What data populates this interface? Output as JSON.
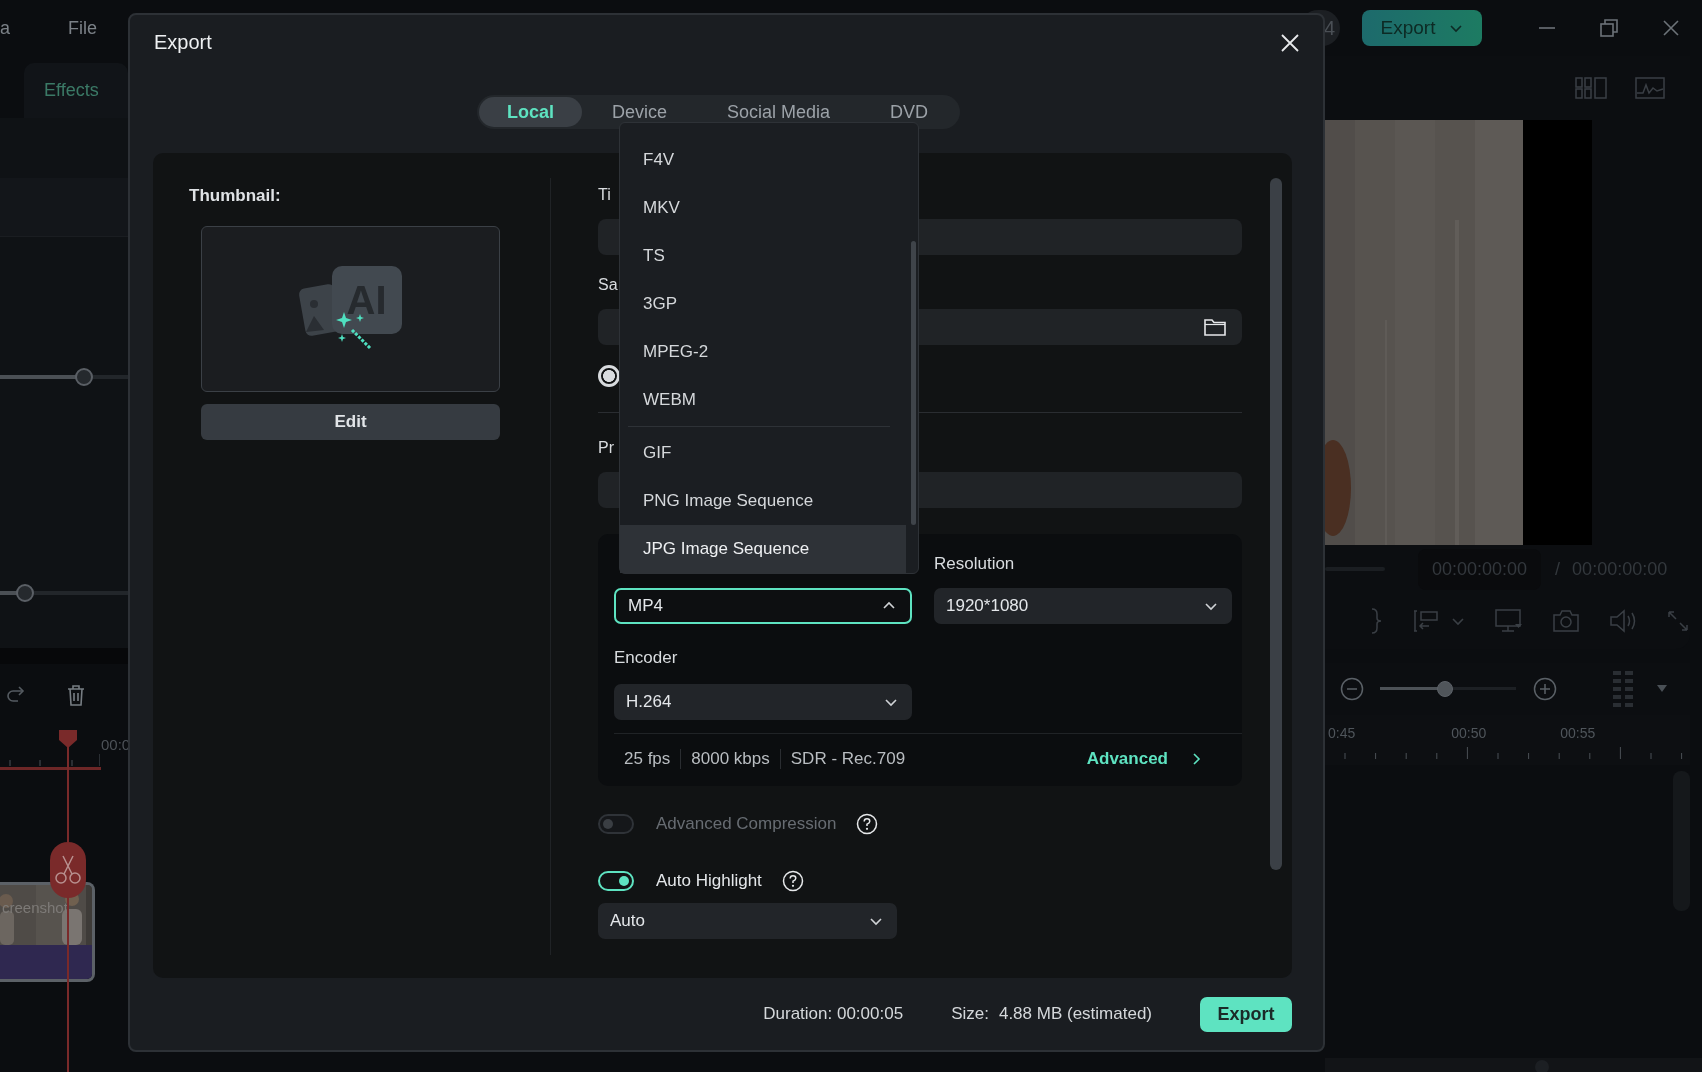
{
  "app_menu": [
    {
      "label": "a"
    },
    {
      "label": "File"
    }
  ],
  "top_bar": {
    "badge": "4",
    "export_button": "Export"
  },
  "left_panel": {
    "tab": "Effects",
    "sliders": [
      {
        "level": 0.65
      },
      {
        "level": 0.19
      }
    ],
    "ruler_label": "00:0",
    "clip_label": "creenshot"
  },
  "player": {
    "current_time": "00:00:00:00",
    "separator": "/",
    "total_time": "00:00:00:00"
  },
  "timeline": {
    "zoom": {
      "level": 0.48
    },
    "ruler_labels": [
      "0:45",
      "00:50",
      "00:55"
    ]
  },
  "dialog": {
    "title": "Export",
    "tabs": [
      {
        "label": "Local",
        "selected": true
      },
      {
        "label": "Device",
        "selected": false
      },
      {
        "label": "Social Media",
        "selected": false
      },
      {
        "label": "DVD",
        "selected": false
      }
    ],
    "thumbnail": {
      "label": "Thumbnail:",
      "badge": "AI",
      "edit_button": "Edit"
    },
    "title_field": {
      "label": "Ti"
    },
    "save_field": {
      "label": "Sa"
    },
    "radio": {
      "checked": true
    },
    "preset_field": {
      "label": "Pr"
    },
    "format": {
      "value": "MP4",
      "expanded": true
    },
    "resolution": {
      "label": "Resolution",
      "value": "1920*1080"
    },
    "encoder": {
      "label": "Encoder",
      "value": "H.264"
    },
    "info": [
      "25 fps",
      "8000 kbps",
      "SDR - Rec.709"
    ],
    "advanced_link": "Advanced",
    "toggles": [
      {
        "label": "Advanced Compression",
        "on": false,
        "disabled": true
      },
      {
        "label": "Auto Highlight",
        "on": true,
        "disabled": false
      }
    ],
    "highlight_select": {
      "value": "Auto"
    },
    "duration": "Duration: 00:00:05",
    "size_label": "Size:",
    "size_value": "4.88 MB (estimated)",
    "export_button": "Export",
    "format_menu": [
      {
        "label": "F4V",
        "selected": false,
        "divider_before": false
      },
      {
        "label": "MKV",
        "selected": false,
        "divider_before": false
      },
      {
        "label": "TS",
        "selected": false,
        "divider_before": false
      },
      {
        "label": "3GP",
        "selected": false,
        "divider_before": false
      },
      {
        "label": "MPEG-2",
        "selected": false,
        "divider_before": false
      },
      {
        "label": "WEBM",
        "selected": false,
        "divider_before": false
      },
      {
        "label": "GIF",
        "selected": false,
        "divider_before": true
      },
      {
        "label": "PNG Image Sequence",
        "selected": false,
        "divider_before": false
      },
      {
        "label": "JPG Image Sequence",
        "selected": true,
        "divider_before": false
      }
    ]
  }
}
